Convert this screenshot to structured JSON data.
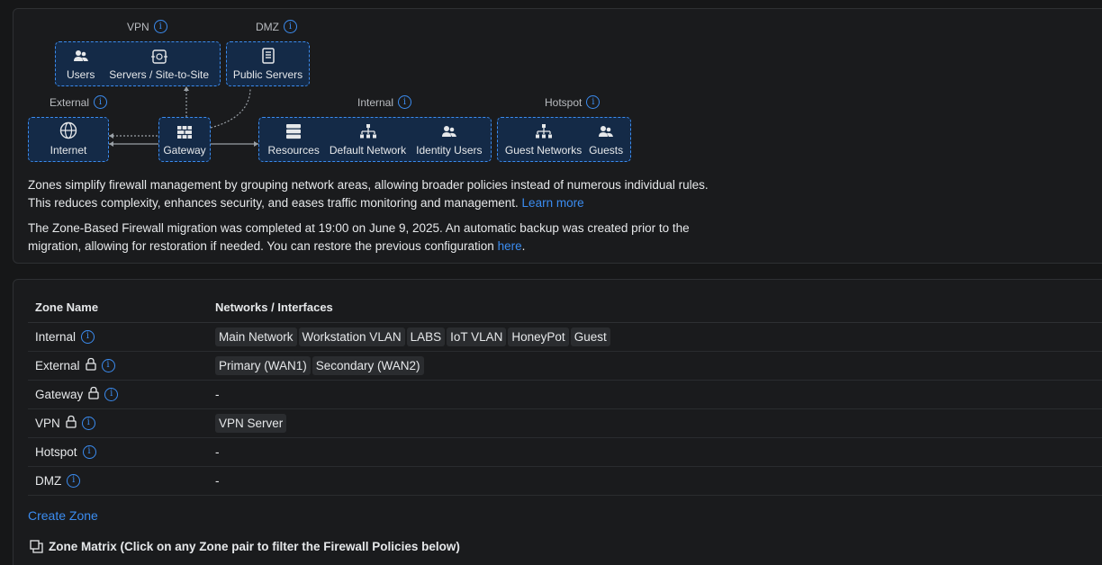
{
  "diagram": {
    "vpn": {
      "label": "VPN",
      "nodes": [
        "Users",
        "Servers / Site-to-Site"
      ]
    },
    "dmz": {
      "label": "DMZ",
      "nodes": [
        "Public Servers"
      ]
    },
    "external": {
      "label": "External",
      "nodes": [
        "Internet"
      ]
    },
    "gateway": {
      "nodes": [
        "Gateway"
      ]
    },
    "internal": {
      "label": "Internal",
      "nodes": [
        "Resources",
        "Default Network",
        "Identity Users"
      ]
    },
    "hotspot": {
      "label": "Hotspot",
      "nodes": [
        "Guest Networks",
        "Guests"
      ]
    }
  },
  "description": {
    "line1": "Zones simplify firewall management by grouping network areas, allowing broader policies instead of numerous individual rules.",
    "line2": "This reduces complexity, enhances security, and eases traffic monitoring and management.",
    "learn_more": "Learn more",
    "migration1": "The Zone-Based Firewall migration was completed at 19:00 on June 9, 2025. An automatic backup was created prior to the",
    "migration2": "migration, allowing for restoration if needed. You can restore the previous configuration",
    "here": "here",
    "period": "."
  },
  "table": {
    "headers": [
      "Zone Name",
      "Networks / Interfaces"
    ],
    "rows": [
      {
        "name": "Internal",
        "locked": false,
        "networks": [
          "Main Network",
          "Workstation VLAN",
          "LABS",
          "IoT VLAN",
          "HoneyPot",
          "Guest"
        ]
      },
      {
        "name": "External",
        "locked": true,
        "networks": [
          "Primary (WAN1)",
          "Secondary (WAN2)"
        ]
      },
      {
        "name": "Gateway",
        "locked": true,
        "empty": "-"
      },
      {
        "name": "VPN",
        "locked": true,
        "networks": [
          "VPN Server"
        ]
      },
      {
        "name": "Hotspot",
        "locked": false,
        "empty": "-"
      },
      {
        "name": "DMZ",
        "locked": false,
        "empty": "-"
      }
    ]
  },
  "create_zone": "Create Zone",
  "zone_matrix": "Zone Matrix (Click on any Zone pair to filter the Firewall Policies below)",
  "colors": {
    "accent": "#3b8cf0",
    "zone_fill": "#142a47",
    "background": "#161718"
  }
}
